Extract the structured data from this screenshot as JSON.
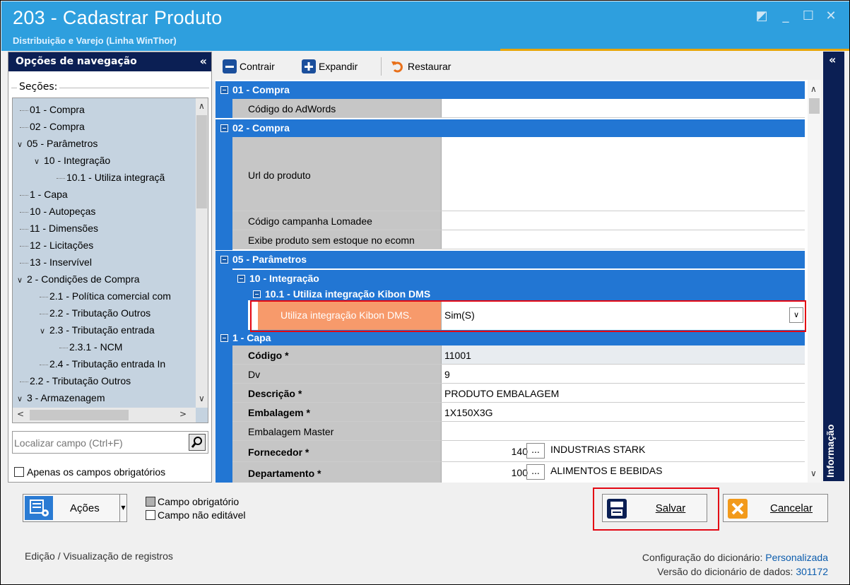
{
  "window": {
    "title": "203 - Cadastrar  Produto",
    "subtitle": "Distribuição e Varejo (Linha WinThor)"
  },
  "nav": {
    "header": "Opções de navegação",
    "sections_label": "Seções:",
    "tree": [
      {
        "label": "01 - Compra"
      },
      {
        "label": "02 - Compra"
      },
      {
        "label": "05 - Parâmetros"
      },
      {
        "label": "10 - Integração"
      },
      {
        "label": "10.1 - Utiliza integraçã"
      },
      {
        "label": "1 - Capa"
      },
      {
        "label": "10 - Autopeças"
      },
      {
        "label": "11 - Dimensões"
      },
      {
        "label": "12 - Licitações"
      },
      {
        "label": "13 - Inservível"
      },
      {
        "label": "2 - Condições de Compra"
      },
      {
        "label": "2.1 - Política comercial com"
      },
      {
        "label": "2.2 - Tributação Outros"
      },
      {
        "label": "2.3 - Tributação entrada"
      },
      {
        "label": "2.3.1 - NCM"
      },
      {
        "label": "2.4 - Tributação entrada In"
      },
      {
        "label": "2.2 - Tributação Outros"
      },
      {
        "label": "3 - Armazenagem"
      }
    ],
    "search_placeholder": "Localizar campo (Ctrl+F)",
    "required_only": "Apenas os campos obrigatórios"
  },
  "toolbar": {
    "contrair": "Contrair",
    "expandir": "Expandir",
    "restaurar": "Restaurar"
  },
  "sections": {
    "s1": "01 - Compra",
    "s2": "02 - Compra",
    "s3": "05 - Parâmetros",
    "s3a": "10 - Integração",
    "s3b": "10.1 - Utiliza integração Kibon DMS",
    "s4": "1 - Capa"
  },
  "fields": {
    "adwords": {
      "label": "Código do AdWords",
      "value": ""
    },
    "url": {
      "label": "Url do produto",
      "value": ""
    },
    "lomadee": {
      "label": "Código campanha Lomadee",
      "value": ""
    },
    "ecomn": {
      "label": "Exibe produto sem estoque no ecomn",
      "value": ""
    },
    "kibon": {
      "label": "Utiliza integração Kibon DMS.",
      "value": "Sim(S)"
    },
    "codigo": {
      "label": "Código *",
      "value": "11001"
    },
    "dv": {
      "label": "Dv",
      "value": "9"
    },
    "descricao": {
      "label": "Descrição *",
      "value": "PRODUTO EMBALAGEM"
    },
    "embalagem": {
      "label": "Embalagem *",
      "value": "1X150X3G"
    },
    "emb_master": {
      "label": "Embalagem Master",
      "value": ""
    },
    "fornecedor": {
      "label": "Fornecedor *",
      "code": "140",
      "ellipsis": "...",
      "name": "INDUSTRIAS STARK"
    },
    "departamento": {
      "label": "Departamento *",
      "code": "100",
      "ellipsis": "...",
      "name": "ALIMENTOS E BEBIDAS"
    }
  },
  "sidebar": {
    "label": "Informação"
  },
  "bottom": {
    "acoes": "Ações",
    "legend_required": "Campo obrigatório",
    "legend_readonly": "Campo não editável",
    "salvar": "Salvar",
    "cancelar": "Cancelar"
  },
  "status": {
    "left": "Edição / Visualização de registros",
    "config_label": "Configuração do dicionário:",
    "config_value": "Personalizada",
    "version_label": "Versão do dicionário de dados:",
    "version_value": "301172"
  },
  "colors": {
    "titlebar": "#2e9fde",
    "section": "#2276d3",
    "nav_header": "#0b1f54",
    "highlight": "#f79a6b",
    "redbox": "#e30613"
  }
}
